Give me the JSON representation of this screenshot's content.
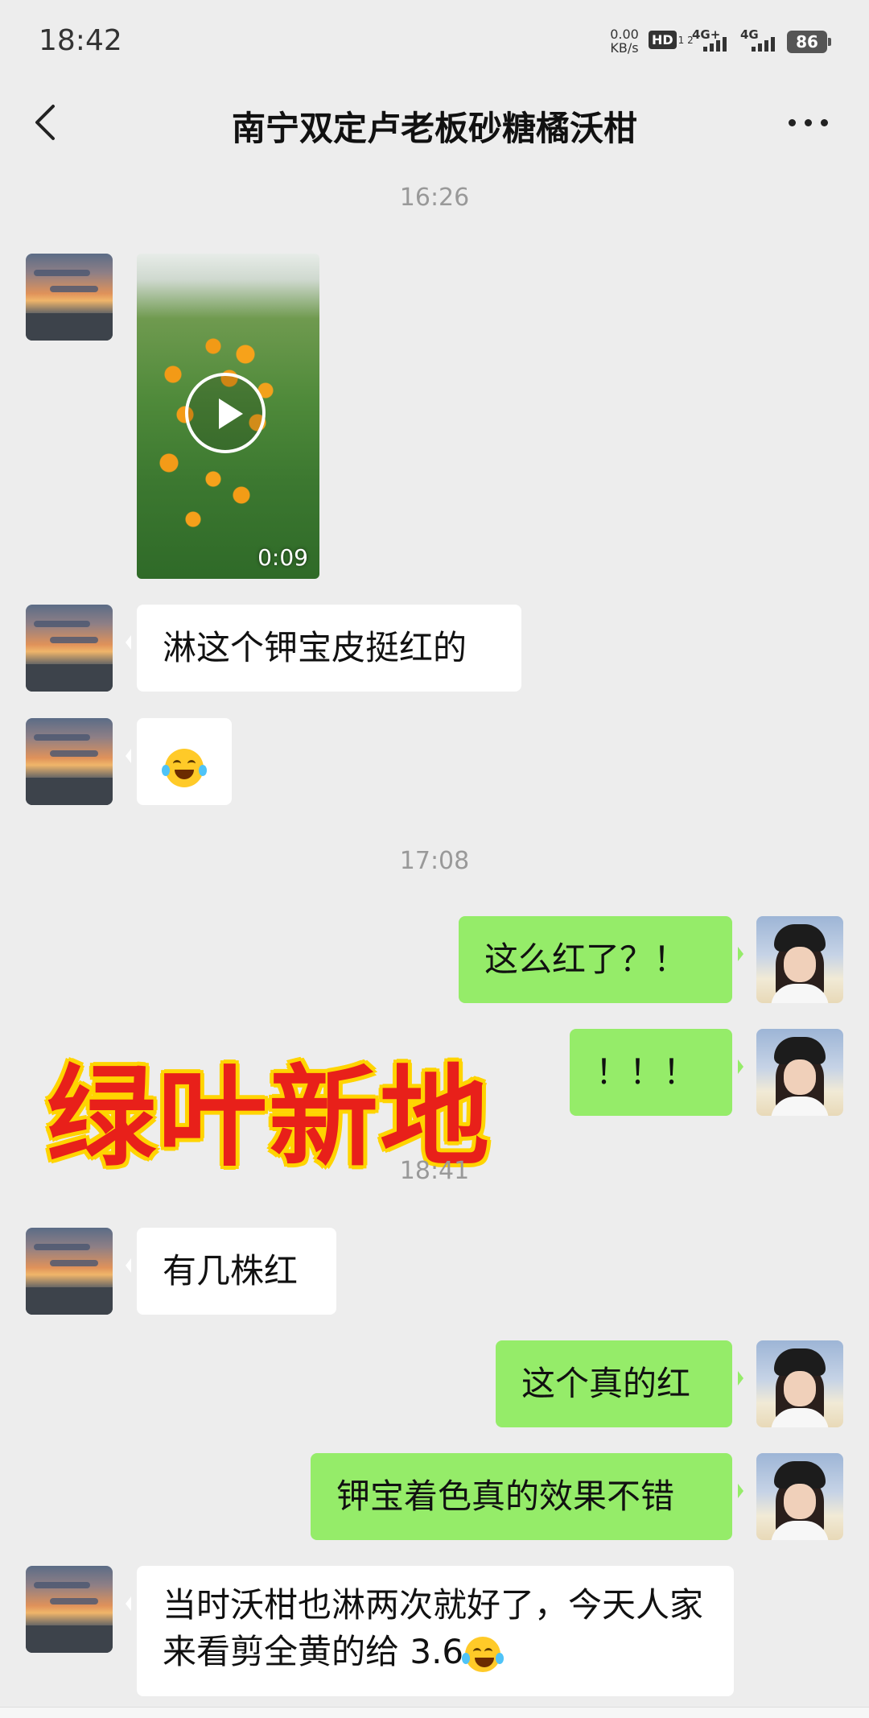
{
  "status_bar": {
    "time": "18:42",
    "net_speed_value": "0.00",
    "net_speed_unit": "KB/s",
    "hd_label": "HD",
    "hd_sub": "1 2",
    "net1_label": "4G+",
    "net2_label": "4G",
    "battery": "86"
  },
  "header": {
    "title": "南宁双定卢老板砂糖橘沃柑",
    "back_icon": "chevron-left-icon",
    "more_icon": "more-dots-icon"
  },
  "chat": {
    "timestamps": [
      "16:26",
      "17:08",
      "18:41"
    ],
    "video": {
      "duration": "0:09"
    },
    "messages": [
      {
        "side": "left",
        "text": "淋这个钾宝皮挺红的"
      },
      {
        "side": "left",
        "emoji": "laughing-tears-emoji"
      },
      {
        "side": "right",
        "text": "这么红了？！"
      },
      {
        "side": "right",
        "text": "！！！"
      },
      {
        "side": "left",
        "text": "有几株红"
      },
      {
        "side": "right",
        "text": "这个真的红"
      },
      {
        "side": "right",
        "text": "钾宝着色真的效果不错"
      },
      {
        "side": "left",
        "text": "当时沃柑也淋两次就好了，今天人家来看剪全黄的给 3.6"
      }
    ]
  },
  "watermark": "绿叶新地",
  "colors": {
    "background": "#ededed",
    "bubble_right": "#95ec69",
    "bubble_left": "#ffffff",
    "watermark_fill": "#e8201a",
    "watermark_outline": "#ffd400"
  }
}
